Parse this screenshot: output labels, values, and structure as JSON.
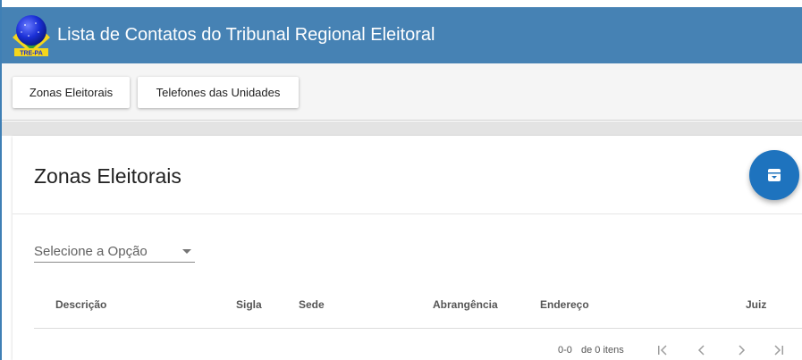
{
  "app": {
    "title": "Lista de Contatos do Tribunal Regional Eleitoral",
    "logo_text": "TRE-PA"
  },
  "tabs": [
    {
      "label": "Zonas Eleitorais"
    },
    {
      "label": "Telefones das Unidades"
    }
  ],
  "card": {
    "title": "Zonas Eleitorais",
    "fab_icon": "archive-icon"
  },
  "filter": {
    "placeholder": "Selecione a Opção"
  },
  "table": {
    "columns": [
      "Descrição",
      "Sigla",
      "Sede",
      "Abrangência",
      "Endereço",
      "Juiz"
    ],
    "rows": []
  },
  "paginator": {
    "range": "0-0",
    "of_label": "de 0 itens",
    "icons": [
      "first-page-icon",
      "previous-page-icon",
      "next-page-icon",
      "last-page-icon"
    ]
  },
  "colors": {
    "header": "#4682b4",
    "accent": "#1e73be"
  }
}
